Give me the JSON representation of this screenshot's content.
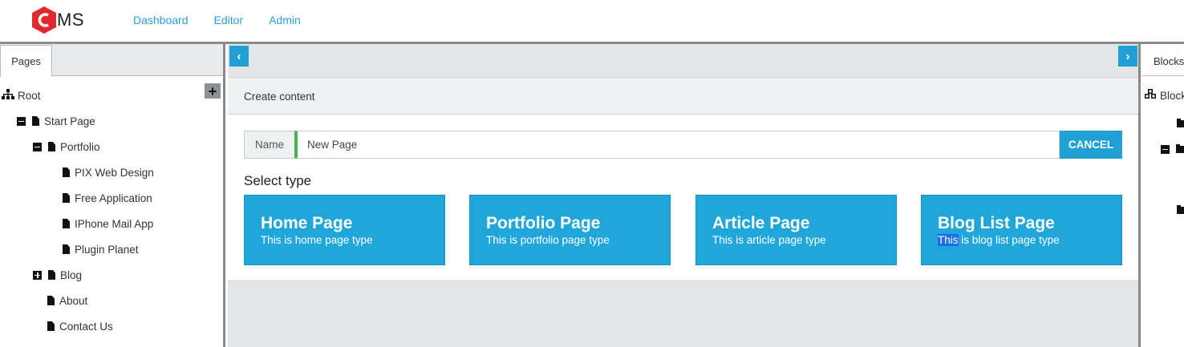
{
  "header": {
    "logo_text": "MS",
    "nav": [
      "Dashboard",
      "Editor",
      "Admin"
    ]
  },
  "left_panel": {
    "tab": "Pages",
    "tree": [
      {
        "label": "Root",
        "icon": "sitemap-icon"
      },
      {
        "label": "Start Page",
        "icon": "file-icon",
        "toggle": "collapse"
      },
      {
        "label": "Portfolio",
        "icon": "file-icon",
        "toggle": "collapse"
      },
      {
        "label": "PIX Web Design",
        "icon": "file-icon"
      },
      {
        "label": "Free Application",
        "icon": "file-icon"
      },
      {
        "label": "IPhone Mail App",
        "icon": "file-icon"
      },
      {
        "label": "Plugin Planet",
        "icon": "file-icon"
      },
      {
        "label": "Blog",
        "icon": "file-icon",
        "toggle": "expand"
      },
      {
        "label": "About",
        "icon": "file-icon"
      },
      {
        "label": "Contact Us",
        "icon": "file-icon"
      }
    ]
  },
  "content": {
    "header": "Create content",
    "name_label": "Name",
    "name_value": "New Page",
    "cancel_label": "CANCEL",
    "select_type": "Select type",
    "cards": [
      {
        "title": "Home Page",
        "desc": "This is home page type"
      },
      {
        "title": "Portfolio Page",
        "desc": "This is portfolio page type"
      },
      {
        "title": "Article Page",
        "desc": "This is article page type"
      },
      {
        "title": "Blog List Page",
        "desc_highlight": "This",
        "desc_rest": " is blog list page type"
      }
    ]
  },
  "right_panel": {
    "tab": "Blocks",
    "root": "Blocks"
  },
  "colors": {
    "accent": "#21a6d9",
    "logo_red": "#e0282e",
    "input_indicator": "#4caf50"
  }
}
